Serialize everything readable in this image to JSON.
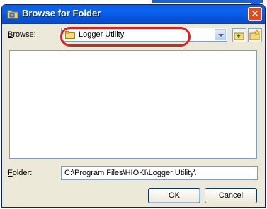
{
  "dialog": {
    "title": "Browse for Folder",
    "close_symbol": "✕"
  },
  "browse": {
    "label_underlined": "B",
    "label_rest": "rowse:",
    "selected_folder": "Logger Utility",
    "folder_icon": "folder-icon"
  },
  "toolbar": {
    "up_icon": "up-one-level-icon",
    "new_icon": "create-new-folder-icon"
  },
  "folder_field": {
    "label_underlined": "F",
    "label_rest": "older:",
    "value": "C:\\Program Files\\HIOKI\\Logger Utility\\"
  },
  "buttons": {
    "ok": "OK",
    "cancel": "Cancel"
  },
  "colors": {
    "highlight": "#e01f20",
    "titlebar": "#0b63f0",
    "window_bg": "#ece9d8"
  }
}
